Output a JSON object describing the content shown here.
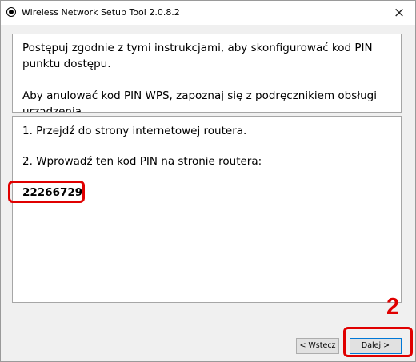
{
  "window": {
    "title": "Wireless Network Setup Tool 2.0.8.2",
    "close_symbol": "×",
    "app_icon": "radio-icon"
  },
  "instructions": {
    "line1": "Postępuj zgodnie z tymi instrukcjami, aby skonfigurować kod PIN punktu dostępu.",
    "line2": "Aby anulować kod PIN WPS, zapoznaj się z podręcznikiem obsługi urządzenia."
  },
  "steps": {
    "step1": "1. Przejdź do strony internetowej routera.",
    "step2": "2. Wprowadź ten kod PIN na stronie routera:"
  },
  "pin_code": "22266729",
  "annotation": {
    "step_number": "2",
    "highlight_color": "#e00000"
  },
  "buttons": {
    "back_label": "< Wstecz",
    "next_label": "Dalej >"
  }
}
